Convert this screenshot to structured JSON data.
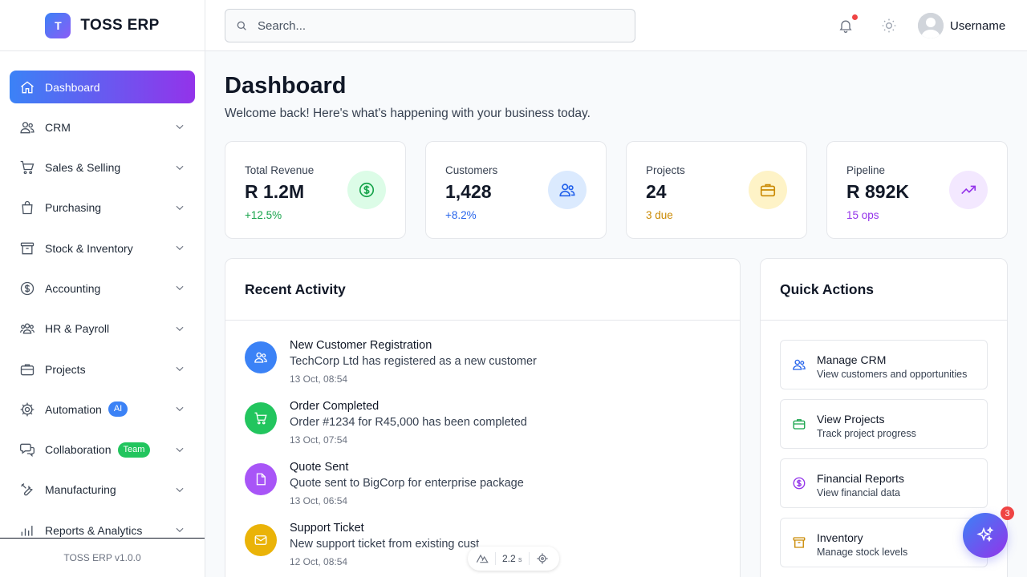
{
  "brand": {
    "logo_letter": "T",
    "name": "TOSS ERP"
  },
  "sidebar": {
    "items": [
      {
        "label": "Dashboard",
        "icon": "home-icon",
        "active": true
      },
      {
        "label": "CRM",
        "icon": "users-icon"
      },
      {
        "label": "Sales & Selling",
        "icon": "cart-icon"
      },
      {
        "label": "Purchasing",
        "icon": "shopping-bag-icon"
      },
      {
        "label": "Stock & Inventory",
        "icon": "archive-box-icon"
      },
      {
        "label": "Accounting",
        "icon": "dollar-circle-icon"
      },
      {
        "label": "HR & Payroll",
        "icon": "user-group-icon"
      },
      {
        "label": "Projects",
        "icon": "briefcase-icon"
      },
      {
        "label": "Automation",
        "icon": "cog-icon",
        "badge": "AI"
      },
      {
        "label": "Collaboration",
        "icon": "chat-bubbles-icon",
        "badge": "Team"
      },
      {
        "label": "Manufacturing",
        "icon": "wrench-screwdriver-icon"
      },
      {
        "label": "Reports & Analytics",
        "icon": "bar-chart-icon"
      }
    ],
    "footer": "TOSS ERP v1.0.0"
  },
  "header": {
    "search_placeholder": "Search...",
    "username": "Username"
  },
  "main": {
    "title": "Dashboard",
    "subtitle": "Welcome back! Here's what's happening with your business today.",
    "stats": [
      {
        "label": "Total Revenue",
        "value": "R 1.2M",
        "delta": "+12.5%",
        "delta_color": "#16a34a",
        "icon": "dollar-circle-icon",
        "icon_bg": "#dcfce7",
        "icon_color": "#16a34a"
      },
      {
        "label": "Customers",
        "value": "1,428",
        "delta": "+8.2%",
        "delta_color": "#2563eb",
        "icon": "users-icon",
        "icon_bg": "#dbeafe",
        "icon_color": "#2563eb"
      },
      {
        "label": "Projects",
        "value": "24",
        "delta": "3 due",
        "delta_color": "#ca8a04",
        "icon": "briefcase-icon",
        "icon_bg": "#fef3c7",
        "icon_color": "#ca8a04"
      },
      {
        "label": "Pipeline",
        "value": "R 892K",
        "delta": "15 ops",
        "delta_color": "#9333ea",
        "icon": "trending-up-icon",
        "icon_bg": "#f3e8ff",
        "icon_color": "#9333ea"
      }
    ],
    "recent_activity": {
      "title": "Recent Activity",
      "items": [
        {
          "title": "New Customer Registration",
          "description": "TechCorp Ltd has registered as a new customer",
          "time": "13 Oct, 08:54",
          "icon": "users-icon",
          "color": "#3b82f6"
        },
        {
          "title": "Order Completed",
          "description": "Order #1234 for R45,000 has been completed",
          "time": "13 Oct, 07:54",
          "icon": "cart-icon",
          "color": "#22c55e"
        },
        {
          "title": "Quote Sent",
          "description": "Quote sent to BigCorp for enterprise package",
          "time": "13 Oct, 06:54",
          "icon": "document-icon",
          "color": "#a855f7"
        },
        {
          "title": "Support Ticket",
          "description": "New support ticket from existing cust",
          "time": "12 Oct, 08:54",
          "icon": "mail-icon",
          "color": "#eab308"
        }
      ]
    },
    "quick_actions": {
      "title": "Quick Actions",
      "items": [
        {
          "title": "Manage CRM",
          "description": "View customers and opportunities",
          "icon": "users-icon",
          "color": "#2563eb"
        },
        {
          "title": "View Projects",
          "description": "Track project progress",
          "icon": "briefcase-icon",
          "color": "#16a34a"
        },
        {
          "title": "Financial Reports",
          "description": "View financial data",
          "icon": "dollar-circle-icon",
          "color": "#9333ea"
        },
        {
          "title": "Inventory",
          "description": "Manage stock levels",
          "icon": "archive-box-icon",
          "color": "#ca8a04"
        }
      ]
    }
  },
  "devtools": {
    "value": "2.2",
    "unit": "s"
  },
  "assistant": {
    "badge": "3"
  }
}
